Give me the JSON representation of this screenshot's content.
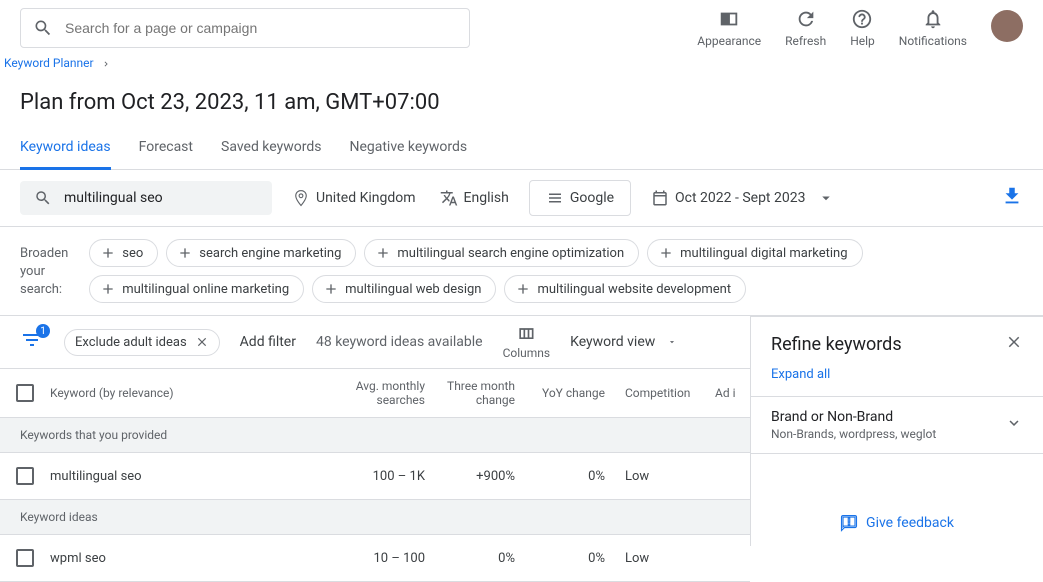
{
  "search": {
    "placeholder": "Search for a page or campaign"
  },
  "header_actions": {
    "appearance": "Appearance",
    "refresh": "Refresh",
    "help": "Help",
    "notifications": "Notifications"
  },
  "breadcrumb": {
    "label": "Keyword Planner"
  },
  "page_title": "Plan from Oct 23, 2023, 11 am, GMT+07:00",
  "tabs": [
    {
      "label": "Keyword ideas",
      "active": true
    },
    {
      "label": "Forecast",
      "active": false
    },
    {
      "label": "Saved keywords",
      "active": false
    },
    {
      "label": "Negative keywords",
      "active": false
    }
  ],
  "filters": {
    "keyword": "multilingual seo",
    "location": "United Kingdom",
    "language": "English",
    "network": "Google",
    "date_range": "Oct 2022 - Sept 2023"
  },
  "broaden": {
    "label": "Broaden your search:",
    "chips": [
      "seo",
      "search engine marketing",
      "multilingual search engine optimization",
      "multilingual digital marketing",
      "multilingual online marketing",
      "multilingual web design",
      "multilingual website development"
    ]
  },
  "toolbar": {
    "filter_badge": "1",
    "exclude_label": "Exclude adult ideas",
    "add_filter": "Add filter",
    "count": "48 keyword ideas available",
    "columns": "Columns",
    "view": "Keyword view"
  },
  "refine": {
    "title": "Refine keywords",
    "expand": "Expand all",
    "group_title": "Brand or Non-Brand",
    "group_sub": "Non-Brands, wordpress, weglot",
    "feedback": "Give feedback"
  },
  "table": {
    "headers": {
      "keyword": "Keyword (by relevance)",
      "search": "Avg. monthly searches",
      "change": "Three month change",
      "yoy": "YoY change",
      "comp": "Competition",
      "ad": "Ad i"
    },
    "section1": "Keywords that you provided",
    "section2": "Keyword ideas",
    "rows": [
      {
        "keyword": "multilingual seo",
        "search": "100 – 1K",
        "change": "+900%",
        "yoy": "0%",
        "comp": "Low"
      },
      {
        "keyword": "wpml seo",
        "search": "10 – 100",
        "change": "0%",
        "yoy": "0%",
        "comp": "Low"
      }
    ]
  }
}
